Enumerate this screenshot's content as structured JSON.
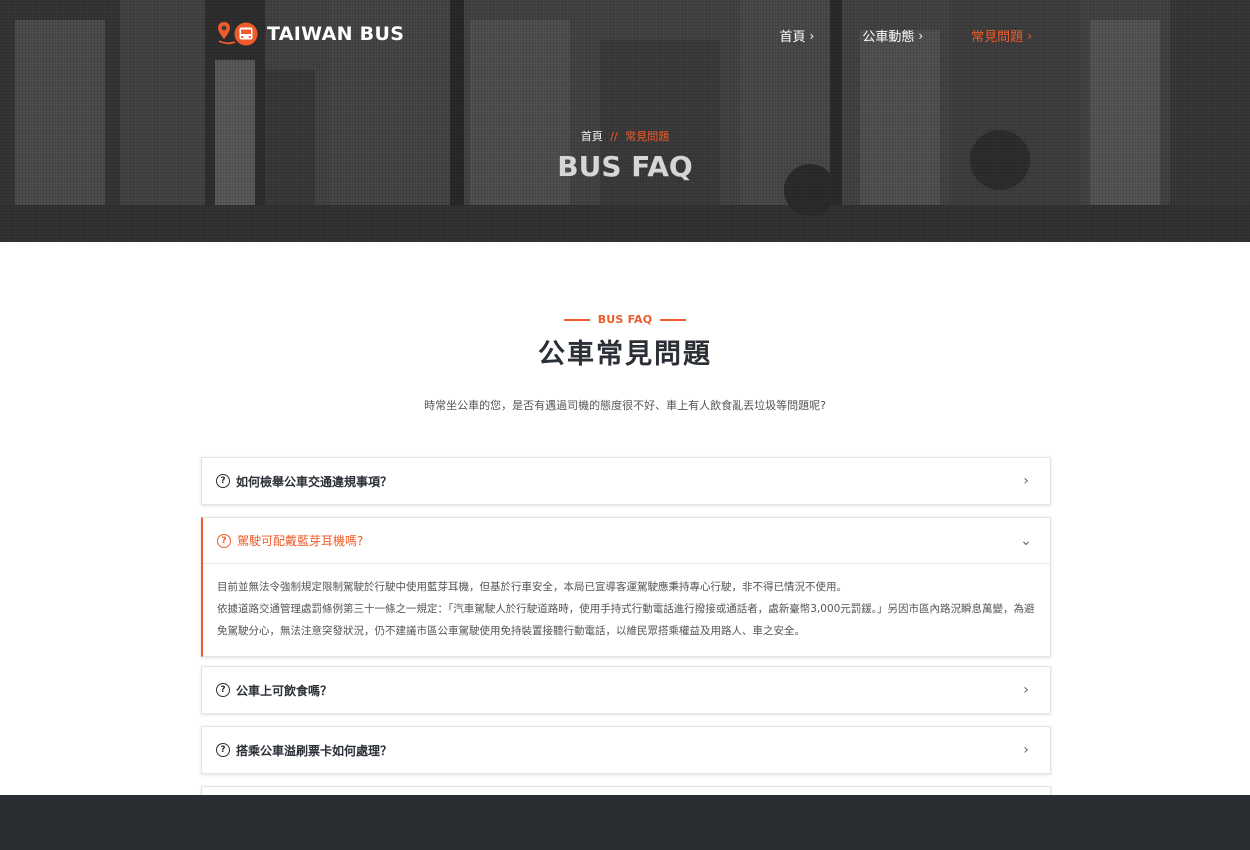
{
  "brand": {
    "name": "TAIWAN BUS",
    "accent": "#ef5b2b"
  },
  "nav": [
    {
      "label": "首頁",
      "active": false
    },
    {
      "label": "公車動態",
      "active": false
    },
    {
      "label": "常見問題",
      "active": true
    }
  ],
  "nav_chevron": "›",
  "hero": {
    "breadcrumb_home": "首頁",
    "breadcrumb_sep": "//",
    "breadcrumb_current": "常見問題",
    "title": "BUS FAQ"
  },
  "section": {
    "tag": "BUS FAQ",
    "title": "公車常見問題",
    "description": "時常坐公車的您，是否有遇過司機的態度很不好、車上有人飲食亂丟垃圾等問題呢?"
  },
  "faq": [
    {
      "question": "如何檢舉公車交通違規事項？",
      "expanded": false
    },
    {
      "question": "駕駛可配戴藍芽耳機嗎?",
      "expanded": true,
      "answer": [
        "目前並無法令強制規定限制駕駛於行駛中使用藍芽耳機，但基於行車安全，本局已宣導客運駕駛應秉持專心行駛，非不得已情況不使用。",
        "依據道路交通管理處罰條例第三十一條之一規定：「汽車駕駛人於行駛道路時，使用手持式行動電話進行撥接或通話者，處新臺幣3,000元罰鍰。」另因市區內路況瞬息萬變，為避免駕駛分心，無法注意突發狀況，仍不建議市區公車駕駛使用免持裝置接聽行動電話，以維民眾搭乘權益及用路人、車之安全。"
      ]
    },
    {
      "question": "公車上可飲食嗎？",
      "expanded": false
    },
    {
      "question": "搭乘公車溢刷票卡如何處理？",
      "expanded": false
    }
  ],
  "icons": {
    "logo_pin": "map-pin-icon",
    "logo_bus": "bus-icon",
    "faq_question": "question-circle-icon",
    "faq_collapsed": "chevron-right-icon",
    "faq_expanded": "chevron-down-icon"
  },
  "glyphs": {
    "question": "?",
    "chevron_right": "›",
    "chevron_down": "⌄"
  }
}
